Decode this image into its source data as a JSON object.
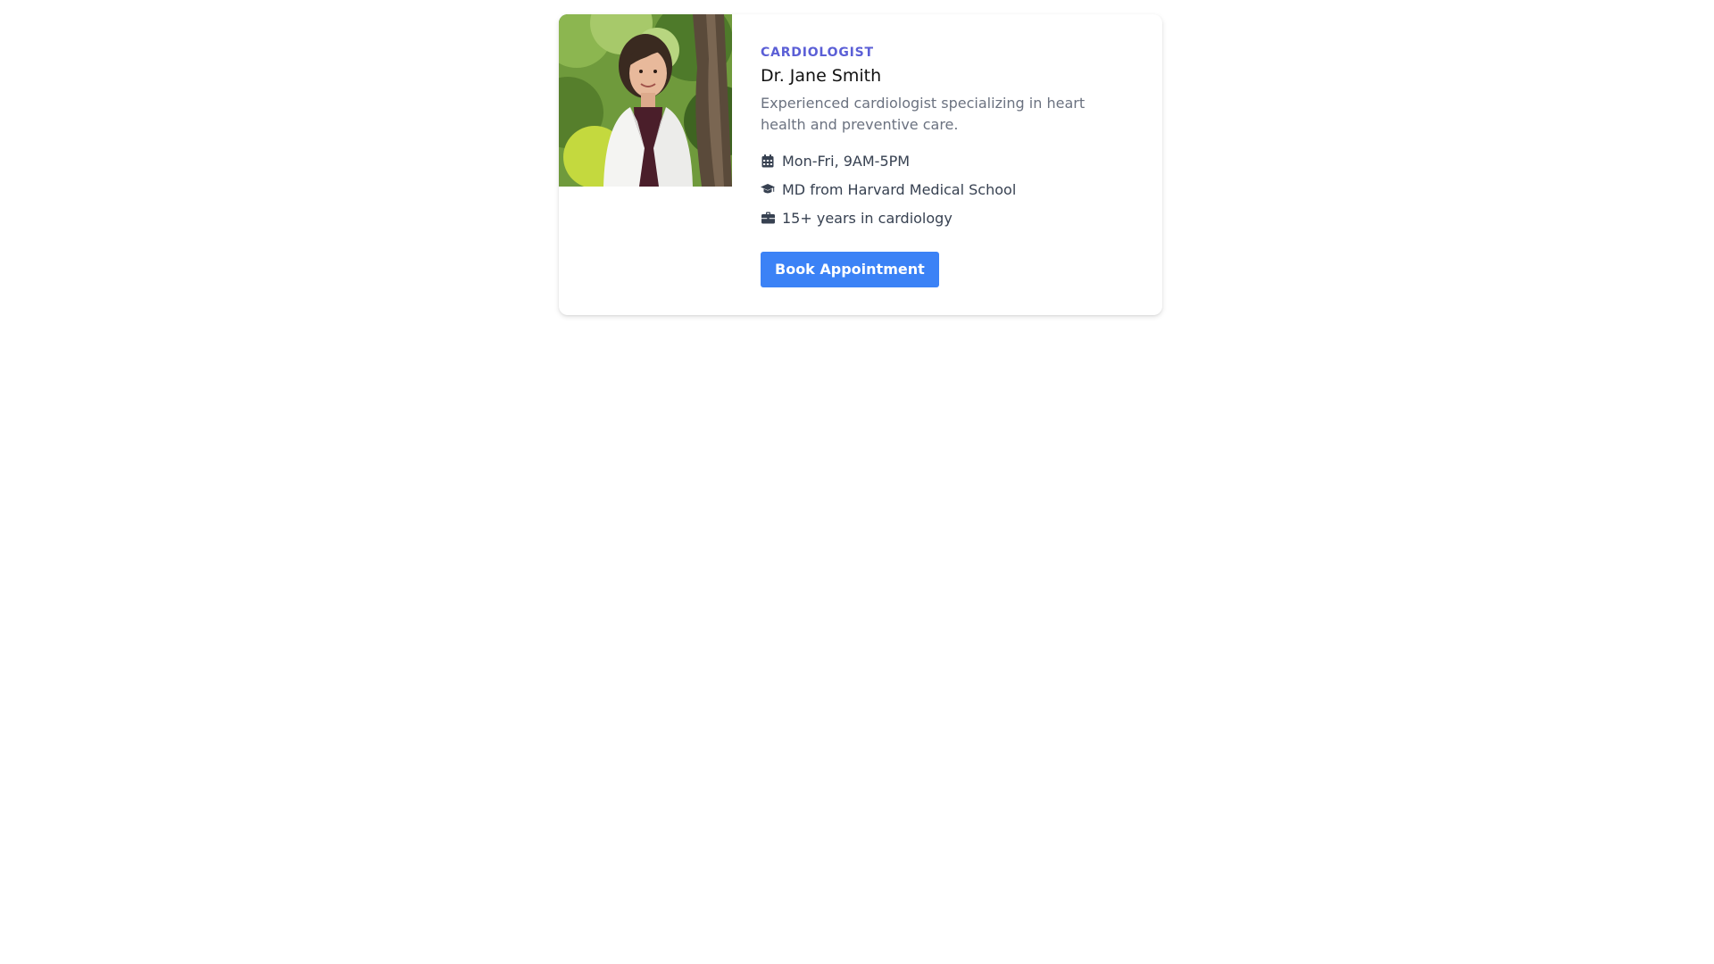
{
  "doctor": {
    "specialty": "CARDIOLOGIST",
    "name": "Dr. Jane Smith",
    "description": "Experienced cardiologist specializing in heart health and preventive care.",
    "photo_alt": "Dr. Jane Smith",
    "details": [
      {
        "icon": "calendar-icon",
        "text": "Mon-Fri, 9AM-5PM"
      },
      {
        "icon": "graduation-cap-icon",
        "text": "MD from Harvard Medical School"
      },
      {
        "icon": "briefcase-icon",
        "text": "15+ years in cardiology"
      }
    ],
    "button_label": "Book Appointment"
  },
  "colors": {
    "accent": "#5b5fd6",
    "button": "#3b82f6",
    "muted_text": "#6b7280",
    "body_text": "#374151"
  }
}
